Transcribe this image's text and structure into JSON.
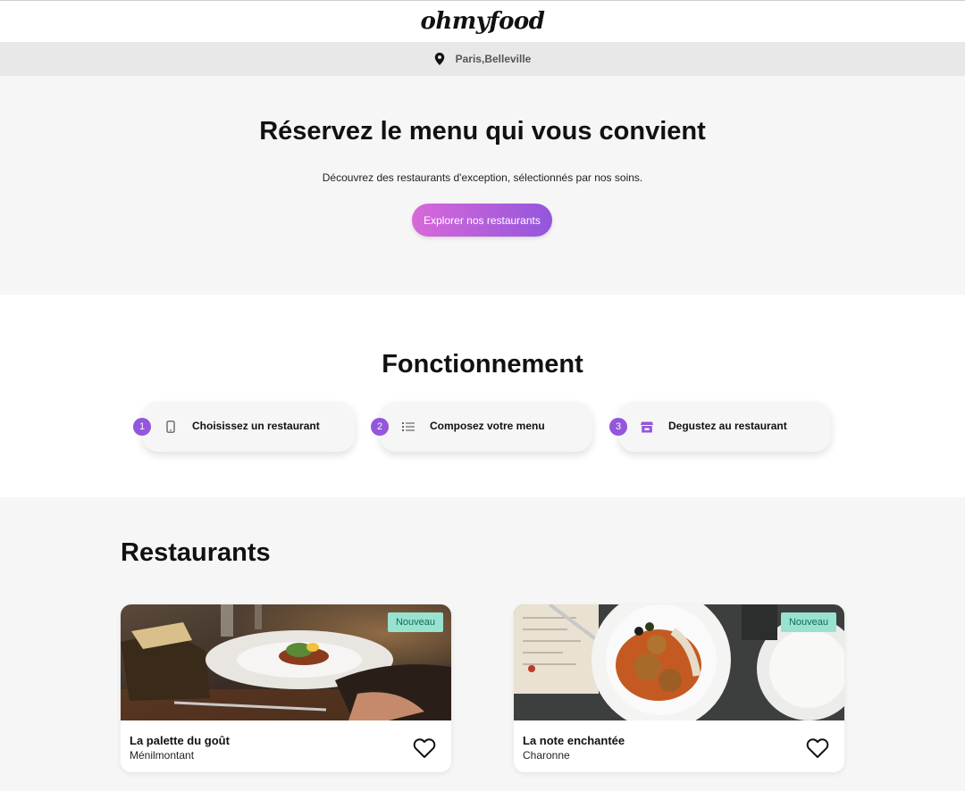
{
  "header": {
    "logo": "ohmyfood",
    "location": "Paris,Belleville",
    "location_icon": "map-pin-icon"
  },
  "hero": {
    "title": "Réservez le menu qui vous convient",
    "subtitle": "Découvrez des restaurants d'exception, sélectionnés par nos soins.",
    "cta_label": "Explorer nos restaurants"
  },
  "how": {
    "title": "Fonctionnement",
    "steps": [
      {
        "number": "1",
        "label": "Choisissez un restaurant",
        "icon": "mobile-phone-icon"
      },
      {
        "number": "2",
        "label": "Composez votre menu",
        "icon": "list-icon"
      },
      {
        "number": "3",
        "label": "Degustez au restaurant",
        "icon": "store-icon"
      }
    ]
  },
  "restaurants": {
    "title": "Restaurants",
    "items": [
      {
        "name": "La palette du goût",
        "area": "Ménilmontant",
        "badge": "Nouveau",
        "favorite_icon": "heart-outline-icon"
      },
      {
        "name": "La note enchantée",
        "area": "Charonne",
        "badge": "Nouveau",
        "favorite_icon": "heart-outline-icon"
      }
    ]
  },
  "colors": {
    "accent_purple": "#9356dc",
    "accent_pink": "#d968d9",
    "badge_bg": "#99e2d0",
    "section_gray": "#f6f6f6"
  }
}
